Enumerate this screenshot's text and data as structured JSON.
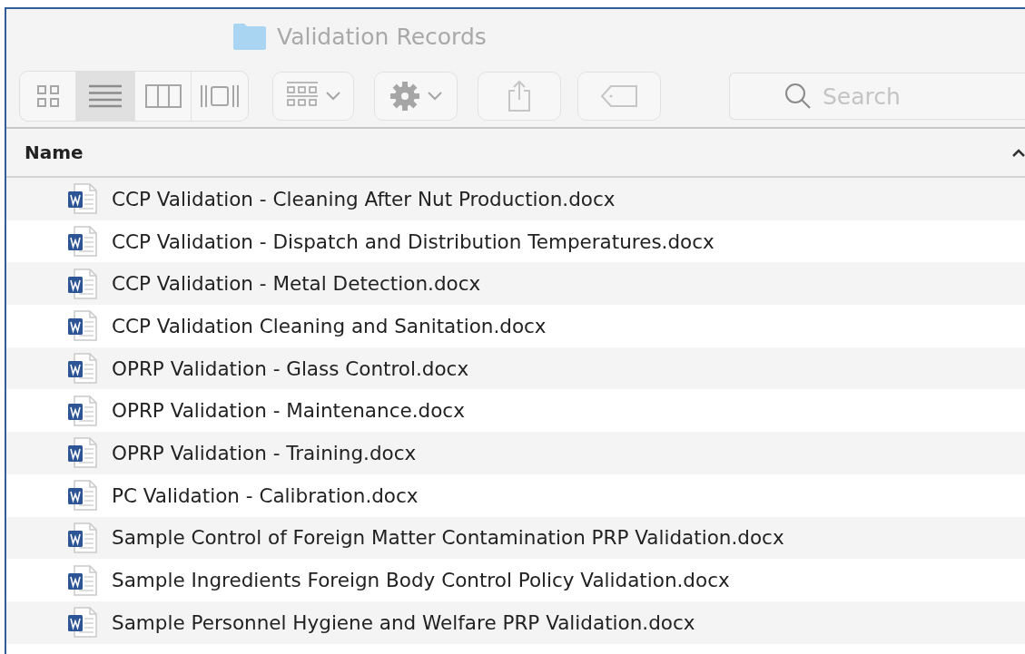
{
  "window": {
    "title": "Validation Records"
  },
  "view_modes": [
    {
      "kind": "icons",
      "selected": false
    },
    {
      "kind": "list",
      "selected": true
    },
    {
      "kind": "columns",
      "selected": false
    },
    {
      "kind": "gallery",
      "selected": false
    }
  ],
  "search": {
    "placeholder": "Search"
  },
  "table": {
    "columns": [
      {
        "label": "Name",
        "sorted_ascending": true
      }
    ],
    "rows": [
      {
        "name": "CCP Validation - Cleaning After Nut Production.docx"
      },
      {
        "name": "CCP Validation - Dispatch and Distribution Temperatures.docx"
      },
      {
        "name": "CCP Validation - Metal Detection.docx"
      },
      {
        "name": "CCP Validation Cleaning and Sanitation.docx"
      },
      {
        "name": "OPRP Validation - Glass Control.docx"
      },
      {
        "name": "OPRP Validation - Maintenance.docx"
      },
      {
        "name": "OPRP Validation - Training.docx"
      },
      {
        "name": "PC Validation - Calibration.docx"
      },
      {
        "name": "Sample Control of Foreign Matter Contamination PRP Validation.docx"
      },
      {
        "name": "Sample Ingredients Foreign Body Control Policy Validation.docx"
      },
      {
        "name": "Sample Personnel Hygiene and Welfare PRP Validation.docx"
      }
    ]
  }
}
